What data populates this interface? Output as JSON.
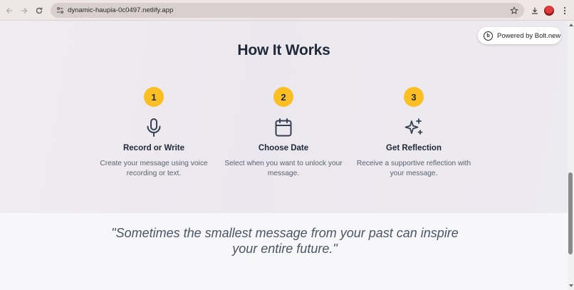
{
  "browser": {
    "url": "dynamic-haupia-0c0497.netlify.app"
  },
  "badge": {
    "label": "Powered by Bolt.new",
    "logo_letter": "b"
  },
  "how_it_works": {
    "title": "How It Works",
    "steps": [
      {
        "number": "1",
        "icon": "microphone-icon",
        "title": "Record or Write",
        "desc": "Create your message using voice recording or text."
      },
      {
        "number": "2",
        "icon": "calendar-icon",
        "title": "Choose Date",
        "desc": "Select when you want to unlock your message."
      },
      {
        "number": "3",
        "icon": "sparkles-icon",
        "title": "Get Reflection",
        "desc": "Receive a supportive reflection with your message."
      }
    ]
  },
  "quote": {
    "line1": "\"Sometimes the smallest message from your past can inspire",
    "line2": "your entire future.\""
  },
  "colors": {
    "accent": "#fbbf24",
    "heading": "#1f2937",
    "body_text": "#5b6270"
  }
}
